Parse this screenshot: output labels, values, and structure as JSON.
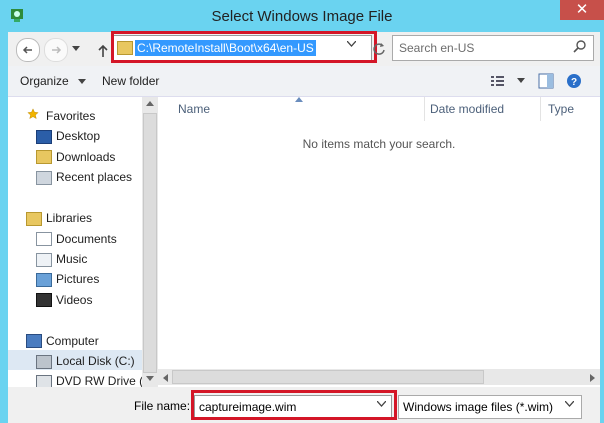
{
  "window": {
    "title": "Select Windows Image File",
    "close_glyph": "✕"
  },
  "nav": {
    "address": "C:\\RemoteInstall\\Boot\\x64\\en-US",
    "search_placeholder": "Search en-US"
  },
  "toolbar": {
    "organize": "Organize",
    "new_folder": "New folder"
  },
  "sidebar": {
    "favorites": "Favorites",
    "desktop": "Desktop",
    "downloads": "Downloads",
    "recent_places": "Recent places",
    "libraries": "Libraries",
    "documents": "Documents",
    "music": "Music",
    "pictures": "Pictures",
    "videos": "Videos",
    "computer": "Computer",
    "local_disk": "Local Disk (C:)",
    "dvd": "DVD RW Drive (D"
  },
  "columns": {
    "name": "Name",
    "date_modified": "Date modified",
    "type": "Type"
  },
  "content": {
    "empty_message": "No items match your search."
  },
  "bottom": {
    "file_name_label": "File name:",
    "file_name_value": "captureimage.wim",
    "file_type_value": "Windows image files (*.wim)"
  },
  "colors": {
    "accent_titlebar": "#6ad3f0",
    "highlight_border": "#d41627",
    "selection": "#3399ff"
  }
}
